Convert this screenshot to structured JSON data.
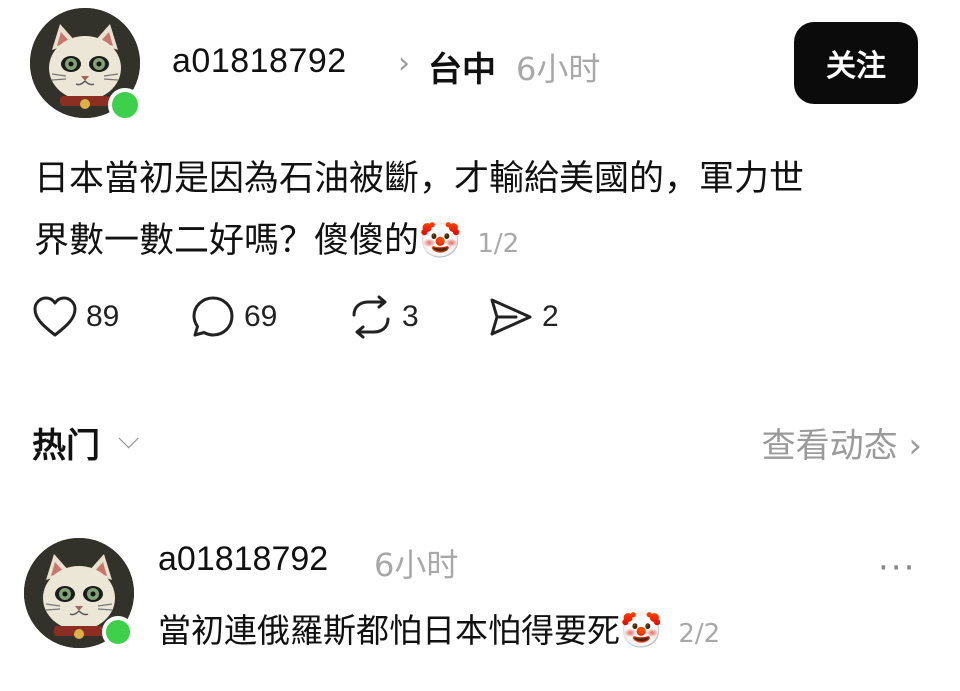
{
  "post": {
    "username": "a01818792",
    "location": "台中",
    "time": "6小时",
    "follow_label": "关注",
    "text_line1": "日本當初是因為石油被斷，才輸給美國的，軍力世",
    "text_line2": "界數一數二好嗎？傻傻的",
    "emoji": "🤡",
    "page_indicator": "1/2",
    "stats": {
      "likes": "89",
      "comments": "69",
      "reposts": "3",
      "shares": "2"
    }
  },
  "hot_section": {
    "label": "热门",
    "view_label": "查看动态 ›"
  },
  "comment": {
    "username": "a01818792",
    "time": "6小时",
    "text": "當初連俄羅斯都怕日本怕得要死",
    "emoji": "🤡",
    "page_indicator": "2/2",
    "more": "···"
  },
  "icons": {
    "like": "heart-icon",
    "comment": "comment-bubble-icon",
    "repost": "repost-icon",
    "share": "send-icon"
  },
  "colors": {
    "online": "#3ed04a",
    "follow_bg": "#0b0b0b",
    "muted": "#a8a8a8"
  }
}
